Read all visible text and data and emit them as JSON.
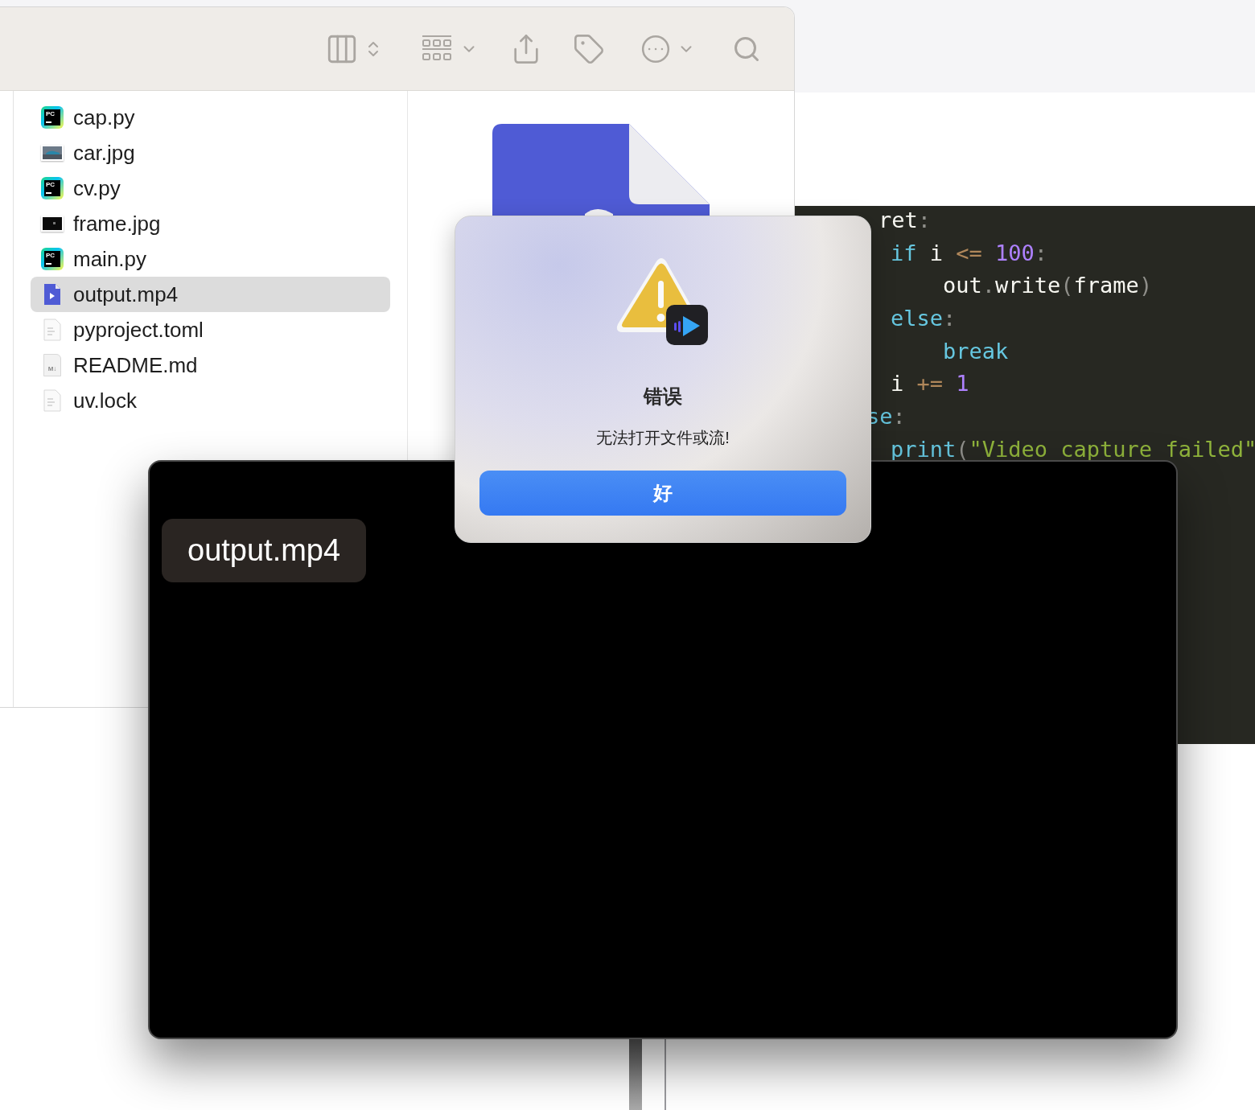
{
  "finder": {
    "files": [
      {
        "name": "cap.py",
        "kind": "python",
        "icon_label": "PC",
        "selected": false
      },
      {
        "name": "car.jpg",
        "selected": false
      },
      {
        "name": "cv.py",
        "kind": "python",
        "icon_label": "PC",
        "selected": false
      },
      {
        "name": "frame.jpg",
        "kind": "dark_image",
        "selected": false
      },
      {
        "name": "main.py",
        "kind": "python",
        "icon_label": "PC",
        "selected": false
      },
      {
        "name": "output.mp4",
        "kind": "video",
        "selected": true
      },
      {
        "name": "pyproject.toml",
        "kind": "text",
        "selected": false
      },
      {
        "name": "README.md",
        "kind": "markdown",
        "icon_label": "M↓",
        "selected": false
      },
      {
        "name": "uv.lock",
        "kind": "text",
        "selected": false
      }
    ]
  },
  "editor": {
    "lines": [
      {
        "kind": "head",
        "tokens": [
          {
            "kind": "name",
            "text": "ret"
          },
          {
            "kind": "punct",
            "text": ":"
          }
        ]
      },
      {
        "kind": "body",
        "tokens": [
          {
            "kind": "keyword",
            "text": "if "
          },
          {
            "kind": "name",
            "text": "i "
          },
          {
            "kind": "operator",
            "text": "<= "
          },
          {
            "kind": "number",
            "text": "100"
          },
          {
            "kind": "punct",
            "text": ":"
          }
        ]
      },
      {
        "kind": "inner",
        "tokens": [
          {
            "kind": "name",
            "text": "out"
          },
          {
            "kind": "punct",
            "text": "."
          },
          {
            "kind": "name",
            "text": "write"
          },
          {
            "kind": "punct",
            "text": "("
          },
          {
            "kind": "name",
            "text": "frame"
          },
          {
            "kind": "punct",
            "text": ")"
          }
        ]
      },
      {
        "kind": "body",
        "tokens": [
          {
            "kind": "keyword",
            "text": "else"
          },
          {
            "kind": "punct",
            "text": ":"
          }
        ]
      },
      {
        "kind": "inner",
        "tokens": [
          {
            "kind": "keyword",
            "text": "break"
          }
        ]
      },
      {
        "kind": "body",
        "tokens": [
          {
            "kind": "name",
            "text": "i "
          },
          {
            "kind": "operator",
            "text": "+= "
          },
          {
            "kind": "number",
            "text": "1"
          }
        ]
      },
      {
        "kind": "tail",
        "tokens": [
          {
            "kind": "keyword",
            "text": "se"
          },
          {
            "kind": "punct",
            "text": ":"
          }
        ]
      },
      {
        "kind": "body",
        "tokens": [
          {
            "kind": "keyword",
            "text": "print"
          },
          {
            "kind": "punct",
            "text": "("
          },
          {
            "kind": "string",
            "text": "\"Video capture failed\""
          }
        ]
      }
    ]
  },
  "player": {
    "title": "output.mp4"
  },
  "alert": {
    "title": "错误",
    "message": "无法打开文件或流!",
    "button": "好"
  }
}
